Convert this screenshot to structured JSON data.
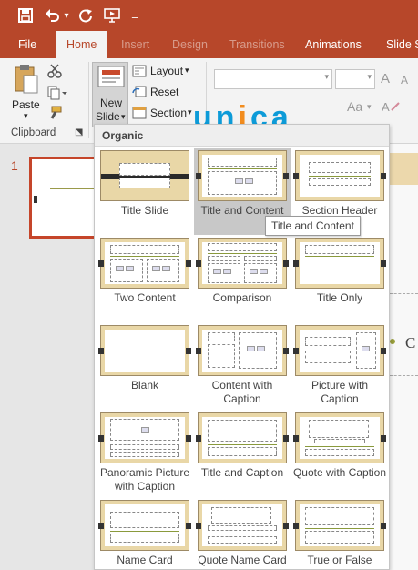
{
  "quick_access": {
    "icons": [
      "save-icon",
      "undo-icon",
      "undo-dropdown-icon",
      "redo-icon",
      "start-from-beginning-icon",
      "customize-toolbar-icon"
    ],
    "dropdown_glyph": "▾",
    "customize_glyph": "="
  },
  "tabs": [
    {
      "label": "File"
    },
    {
      "label": "Home",
      "active": true
    },
    {
      "label": "Insert"
    },
    {
      "label": "Design"
    },
    {
      "label": "Transitions"
    },
    {
      "label": "Animations"
    },
    {
      "label": "Slide S"
    }
  ],
  "ribbon": {
    "paste_label": "Paste",
    "paste_arrow": "▾",
    "new_slide_line1": "New",
    "new_slide_line2": "Slide",
    "new_slide_arrow": "▾",
    "layout_label": "Layout",
    "layout_arrow": "▾",
    "reset_label": "Reset",
    "section_label": "Section",
    "section_arrow": "▾",
    "clipboard_label": "Clipboard",
    "font_grow": "A",
    "font_shrink": "A",
    "change_case": "Aa",
    "change_case_arrow": "▾",
    "dialog_launcher": "⬔"
  },
  "watermark": {
    "part1": "un",
    "part2": "i",
    "part3": "ca"
  },
  "thumbnail_pane": {
    "slide_number": "1"
  },
  "gallery": {
    "header": "Organic",
    "highlighted_index": 1,
    "layouts": [
      {
        "name": "Title Slide"
      },
      {
        "name": "Title and Content"
      },
      {
        "name": "Section Header"
      },
      {
        "name": "Two Content"
      },
      {
        "name": "Comparison"
      },
      {
        "name": "Title Only"
      },
      {
        "name": "Blank"
      },
      {
        "name": "Content with Caption"
      },
      {
        "name": "Picture with Caption"
      },
      {
        "name": "Panoramic Picture with Caption"
      },
      {
        "name": "Title and Caption"
      },
      {
        "name": "Quote with Caption"
      },
      {
        "name": "Name Card"
      },
      {
        "name": "Quote Name Card"
      },
      {
        "name": "True or False"
      }
    ]
  },
  "tooltip": "Title and Content",
  "slide_fragment_text": "C"
}
